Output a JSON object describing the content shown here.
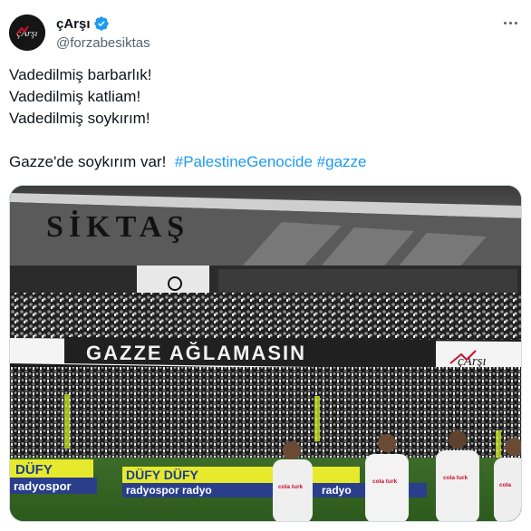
{
  "user": {
    "display_name": "çArşı",
    "handle": "@forzabesiktas",
    "verified_icon": "verified-badge-icon",
    "avatar_text": "çArşı"
  },
  "menu": {
    "more_icon": "more-dots-icon"
  },
  "tweet": {
    "lines": [
      "Vadedilmiş barbarlık!",
      "Vadedilmiş katliam!",
      "Vadedilmiş soykırım!"
    ],
    "final_text": "Gazze'de soykırım var!",
    "hashtags": [
      "#PalestineGenocide",
      "#gazze"
    ]
  },
  "media": {
    "stadium_text": "SİKTAŞ",
    "banner_text": "GAZZE AĞLAMASIN",
    "banner_tag": "çArşı",
    "ad_1": "DÜFY",
    "ad_2": "radyospor",
    "ad_3": "DÜFY DÜFY",
    "ad_4": "radyospor radyo",
    "ad_5": "radyo",
    "kit_1": "cola turk",
    "kit_2": "cola turk",
    "kit_3": "cola turk",
    "kit_4": "cola turk",
    "kit_5": "cola"
  },
  "colors": {
    "text": "#0f1419",
    "secondary": "#536471",
    "link": "#1d9bf0",
    "verified": "#1d9bf0",
    "border": "#cfd9de"
  }
}
